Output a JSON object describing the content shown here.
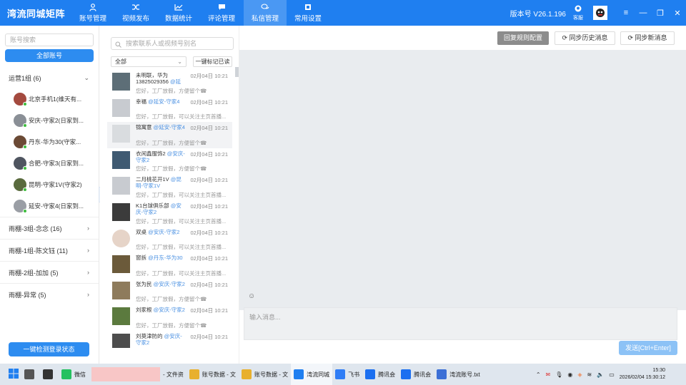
{
  "app": {
    "brand": "湾流同城矩阵",
    "version": "版本号 V26.1.196",
    "service": "客服"
  },
  "nav": [
    {
      "label": "账号管理",
      "icon": "user-icon"
    },
    {
      "label": "视频发布",
      "icon": "shuffle-icon"
    },
    {
      "label": "数据统计",
      "icon": "line-chart-icon"
    },
    {
      "label": "评论管理",
      "icon": "comment-icon"
    },
    {
      "label": "私信管理",
      "icon": "chat-icon",
      "active": true
    },
    {
      "label": "常用设置",
      "icon": "settings-icon"
    }
  ],
  "sidebar": {
    "search_placeholder": "账号搜索",
    "all_label": "全部账号",
    "groups": [
      {
        "label": "运营1组 (6)",
        "expanded": true
      },
      {
        "label": "雨棚-3组-念念 (16)"
      },
      {
        "label": "雨棚-1组-陈文钰 (11)"
      },
      {
        "label": "雨棚-2组-加加 (5)"
      },
      {
        "label": "雨棚-异常 (5)"
      }
    ],
    "accounts": [
      "北京手机1(维天有...",
      "安庆-守家2(日家到...",
      "丹东-华为30(守家...",
      "合肥-守家3(日家到...",
      "昆明-守家1V(守家2)",
      "延安-守家4(日家到..."
    ],
    "detect_button": "一键检测登录状态"
  },
  "conversations": {
    "search_placeholder": "搜索联系人或视频号别名",
    "filter": "全部",
    "mark_all": "一键标记已读",
    "items": [
      {
        "name": "未明联，华为13825029356",
        "tag": "@延安-守家4",
        "time": "02月04日 10:21",
        "preview": "您好，工厂放假，方便留个☎"
      },
      {
        "name": "幸福",
        "tag": "@延安-守家4",
        "time": "02月04日 10:21",
        "preview": "您好，工厂放假，可以关注主页首播..."
      },
      {
        "name": "锦寓意",
        "tag": "@延安-守家4",
        "time": "02月04日 10:21",
        "preview": "您好，工厂放假，方便留个☎"
      },
      {
        "name": "衣闲鑫服饰2",
        "tag": "@安庆-守家2",
        "time": "02月04日 10:21",
        "preview": "您好，工厂放假，方便留个☎"
      },
      {
        "name": "二月桃花开1V",
        "tag": "@昆明-守家1V",
        "time": "02月04日 10:21",
        "preview": "您好，工厂放假，可以关注主页首播..."
      },
      {
        "name": "K1台球俱乐部",
        "tag": "@安庆-守家2",
        "time": "02月04日 10:21",
        "preview": "您好，工厂放假，可以关注主页首播..."
      },
      {
        "name": "双桌",
        "tag": "@安庆-守家2",
        "time": "02月04日 10:21",
        "preview": "您好，工厂放假，可以关注主页首播..."
      },
      {
        "name": "窗拆",
        "tag": "@丹东-华为30",
        "time": "02月04日 10:21",
        "preview": "您好，工厂放假，可以关注主页首播..."
      },
      {
        "name": "张为民",
        "tag": "@安庆-守家2",
        "time": "02月04日 10:21",
        "preview": "您好，工厂放假，方便留个☎"
      },
      {
        "name": "刘家根",
        "tag": "@安庆-守家2",
        "time": "02月04日 10:21",
        "preview": "您好，工厂放假，方便留个☎"
      },
      {
        "name": "刘莫津防的",
        "tag": "@安庆-守家2",
        "time": "02月04日 10:21",
        "preview": ""
      }
    ]
  },
  "chat": {
    "reply_rules": "回复规则配置",
    "sync_history": "同步历史消息",
    "sync_new": "同步新消息",
    "input_placeholder": "输入消息...",
    "send": "发送[Ctrl+Enter]"
  },
  "taskbar": {
    "items": [
      {
        "label": "微信",
        "color": "#25c160"
      },
      {
        "label": "- 文件资",
        "color": "#e8b02e"
      },
      {
        "label": "账号数据 - 文",
        "color": "#e8b02e"
      },
      {
        "label": "账号数据 - 文",
        "color": "#e8b02e"
      },
      {
        "label": "湾流同城",
        "color": "#1f7ff0"
      },
      {
        "label": "飞书",
        "color": "#2f7df6"
      },
      {
        "label": "腾讯会",
        "color": "#1b6ff0"
      },
      {
        "label": "腾讯会",
        "color": "#1b6ff0"
      },
      {
        "label": "湾流账号.txt",
        "color": "#3b6fd6"
      }
    ],
    "time": "15:30",
    "date": "2026/02/04 15:30:12"
  }
}
